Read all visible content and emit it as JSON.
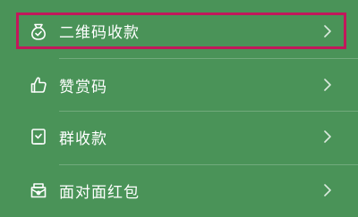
{
  "menu": {
    "items": [
      {
        "label": "二维码收款",
        "icon": "money-bag-icon"
      },
      {
        "label": "赞赏码",
        "icon": "thumbs-up-icon"
      },
      {
        "label": "群收款",
        "icon": "group-collect-icon"
      },
      {
        "label": "面对面红包",
        "icon": "red-packet-icon"
      }
    ],
    "chevron_icon": "chevron-right-icon"
  },
  "colors": {
    "background": "#4a9358",
    "highlight_border": "#c2185b",
    "text": "#ffffff"
  }
}
